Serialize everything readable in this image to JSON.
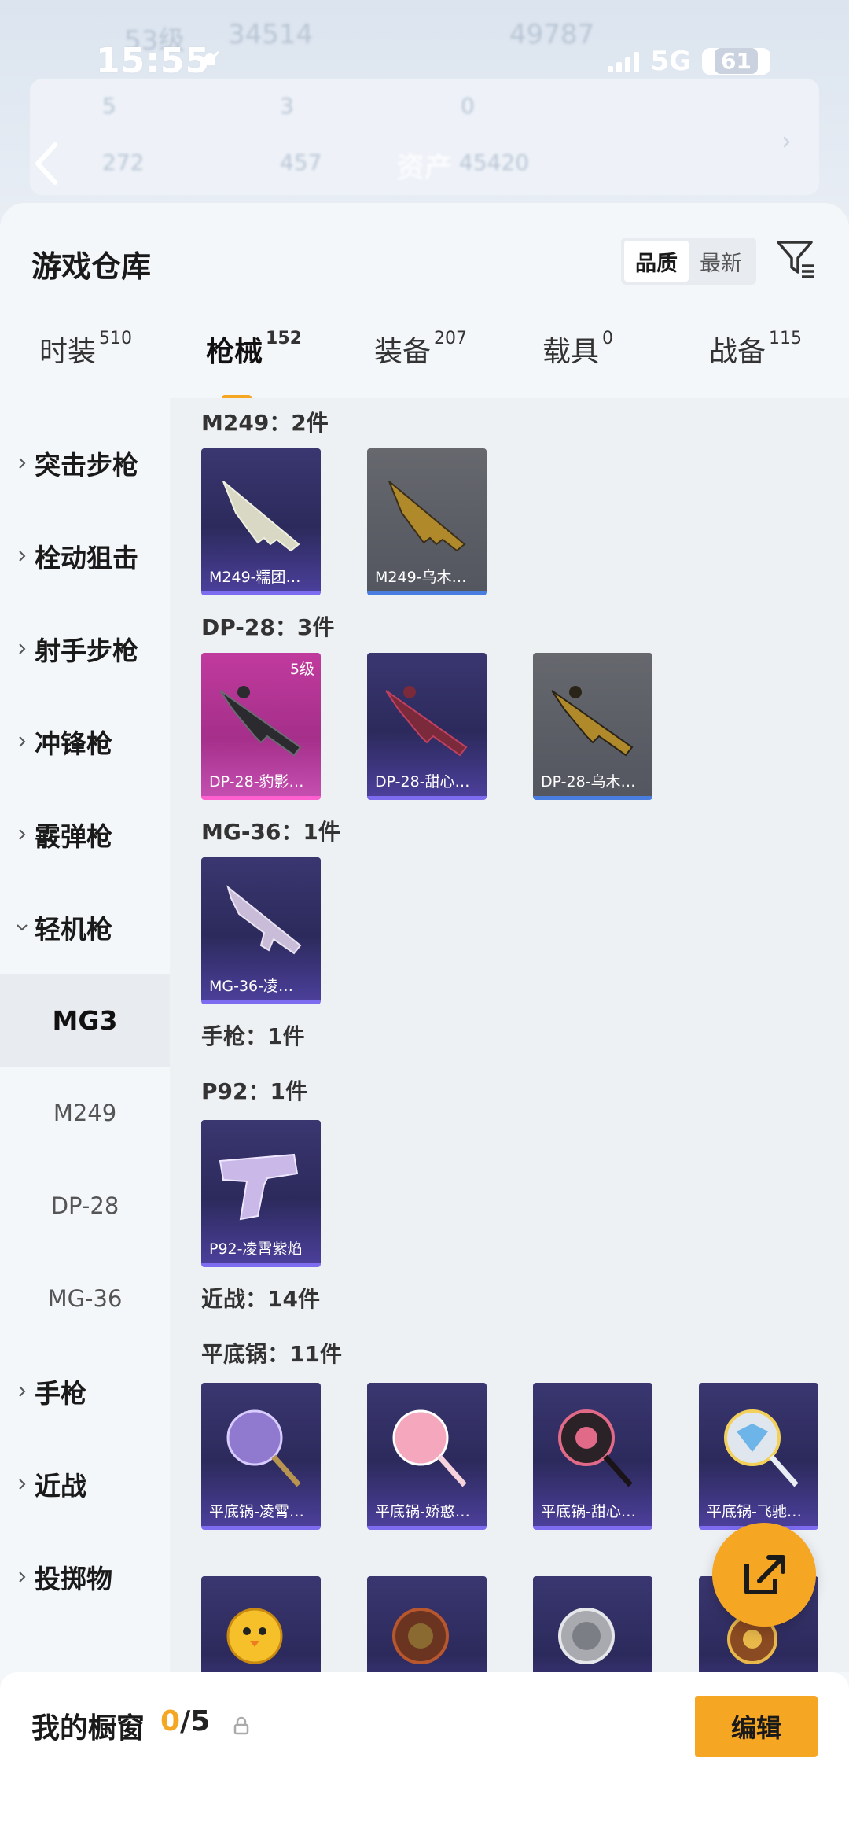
{
  "status_bar": {
    "time": "15:55",
    "network": "5G",
    "battery": "61"
  },
  "background": {
    "ghost_texts": [
      "53级",
      "34514",
      "49787",
      "5",
      "3",
      "0",
      "272",
      "457",
      "资产",
      "45420"
    ]
  },
  "sheet": {
    "title": "游戏仓库",
    "sort_options": [
      "品质",
      "最新"
    ],
    "sort_active": "品质"
  },
  "tabs": [
    {
      "label": "时装",
      "count": "510"
    },
    {
      "label": "枪械",
      "count": "152"
    },
    {
      "label": "装备",
      "count": "207"
    },
    {
      "label": "载具",
      "count": "0"
    },
    {
      "label": "战备",
      "count": "115"
    }
  ],
  "leftnav": {
    "items": [
      "突击步枪",
      "栓动狙击",
      "射手步枪",
      "冲锋枪",
      "霰弹枪",
      "轻机枪"
    ],
    "subitems": [
      "MG3",
      "M249",
      "DP-28",
      "MG-36"
    ],
    "items_after": [
      "手枪",
      "近战",
      "投掷物"
    ]
  },
  "sections": {
    "m249": {
      "title": "M249：2件",
      "cards": [
        "M249-糯团…",
        "M249-乌木…"
      ]
    },
    "dp28": {
      "title": "DP-28：3件",
      "level": "5级",
      "cards": [
        "DP-28-豹影…",
        "DP-28-甜心…",
        "DP-28-乌木…"
      ]
    },
    "mg36": {
      "title": "MG-36：1件",
      "cards": [
        "MG-36-凌…"
      ]
    },
    "pistol": {
      "title": "手枪：1件"
    },
    "p92": {
      "title": "P92：1件",
      "cards": [
        "P92-凌霄紫焰"
      ]
    },
    "melee": {
      "title": "近战：14件"
    },
    "pan": {
      "title": "平底锅：11件",
      "cards": [
        "平底锅-凌霄…",
        "平底锅-娇憨…",
        "平底锅-甜心…",
        "平底锅-飞驰…"
      ]
    }
  },
  "bottom": {
    "title": "我的橱窗",
    "current": "0",
    "total": "/5",
    "edit_label": "编辑"
  }
}
